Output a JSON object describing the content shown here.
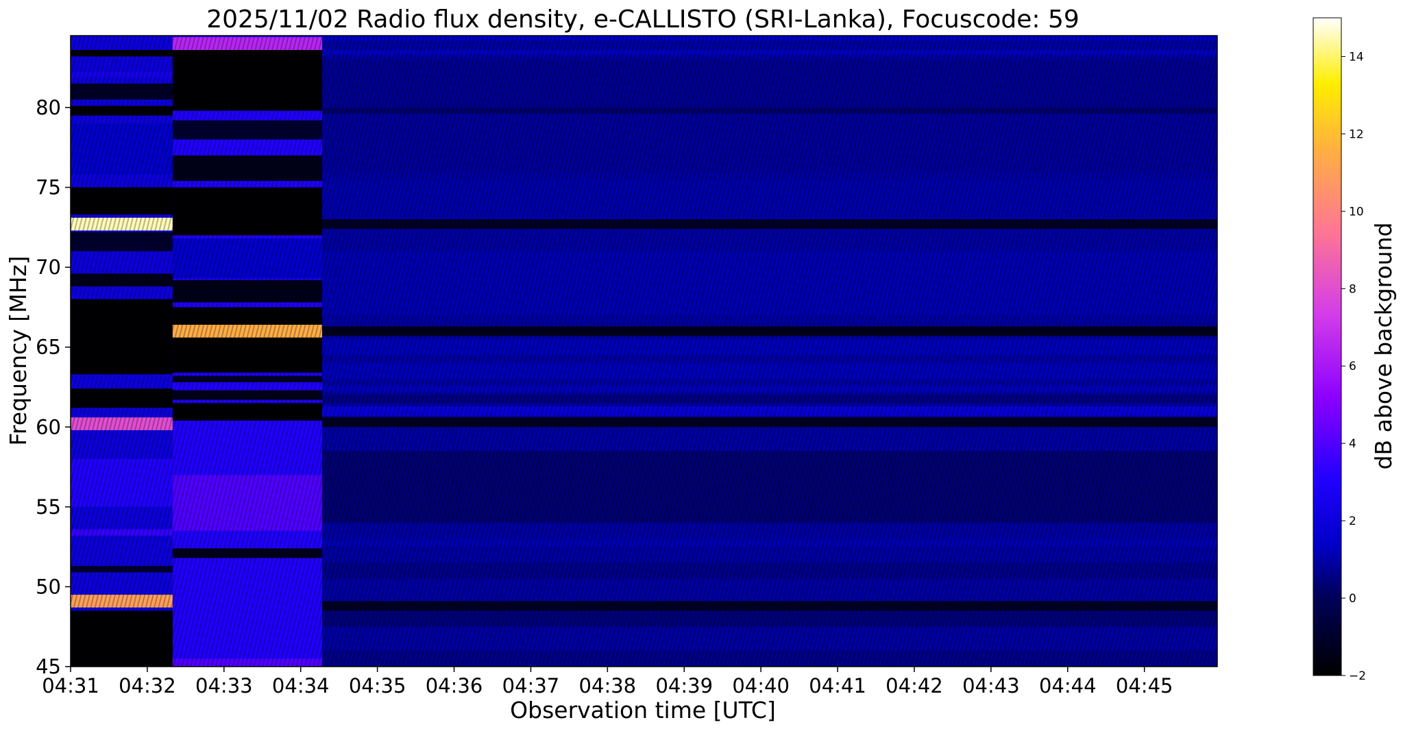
{
  "chart_data": {
    "type": "heatmap",
    "title": "2025/11/02  Radio flux density, e-CALLISTO (SRI-Lanka), Focuscode: 59",
    "xlabel": "Observation time [UTC]",
    "ylabel": "Frequency [MHz]",
    "xticks": [
      "04:31",
      "04:32",
      "04:33",
      "04:34",
      "04:35",
      "04:36",
      "04:37",
      "04:38",
      "04:39",
      "04:40",
      "04:41",
      "04:42",
      "04:43",
      "04:44",
      "04:45"
    ],
    "yticks": [
      45,
      50,
      55,
      60,
      65,
      70,
      75,
      80
    ],
    "xlim_minutes": [
      0,
      14.95
    ],
    "ylim": [
      45,
      84.5
    ],
    "colormap": "gnuplot2",
    "colorbar": {
      "label": "dB above background",
      "ticks": [
        -2,
        0,
        2,
        4,
        6,
        8,
        10,
        12,
        14
      ],
      "range": [
        -2,
        15
      ]
    },
    "segments": [
      {
        "t_start": 0.0,
        "t_end": 1.33,
        "base_db": 2.0,
        "notes": "early sweep, strong 72.7 MHz and 49.1 MHz lines"
      },
      {
        "t_start": 1.33,
        "t_end": 3.28,
        "base_db": 3.0,
        "notes": "bright lower band, strong 66.0 MHz line"
      },
      {
        "t_start": 3.28,
        "t_end": 14.95,
        "base_db": 0.9,
        "notes": "background, dark stripes at 72.7, 66.0, 60.3 and 48.8 MHz"
      }
    ],
    "features": [
      {
        "segment": 0,
        "freq_mhz": 72.7,
        "db": 14.5
      },
      {
        "segment": 0,
        "freq_mhz": 60.2,
        "db": 8.0
      },
      {
        "segment": 0,
        "freq_mhz": 49.1,
        "db": 11.0
      },
      {
        "segment": 1,
        "freq_mhz": 84.0,
        "db": 6.5
      },
      {
        "segment": 1,
        "freq_mhz": 66.0,
        "db": 11.5
      },
      {
        "segment": 2,
        "freq_mhz": 72.7,
        "db": -1.2
      },
      {
        "segment": 2,
        "freq_mhz": 66.0,
        "db": -1.4
      },
      {
        "segment": 2,
        "freq_mhz": 61.0,
        "db": 1.8
      },
      {
        "segment": 2,
        "freq_mhz": 60.3,
        "db": -1.3
      },
      {
        "segment": 2,
        "freq_mhz": 48.8,
        "db": -1.2
      }
    ],
    "grid": false
  }
}
